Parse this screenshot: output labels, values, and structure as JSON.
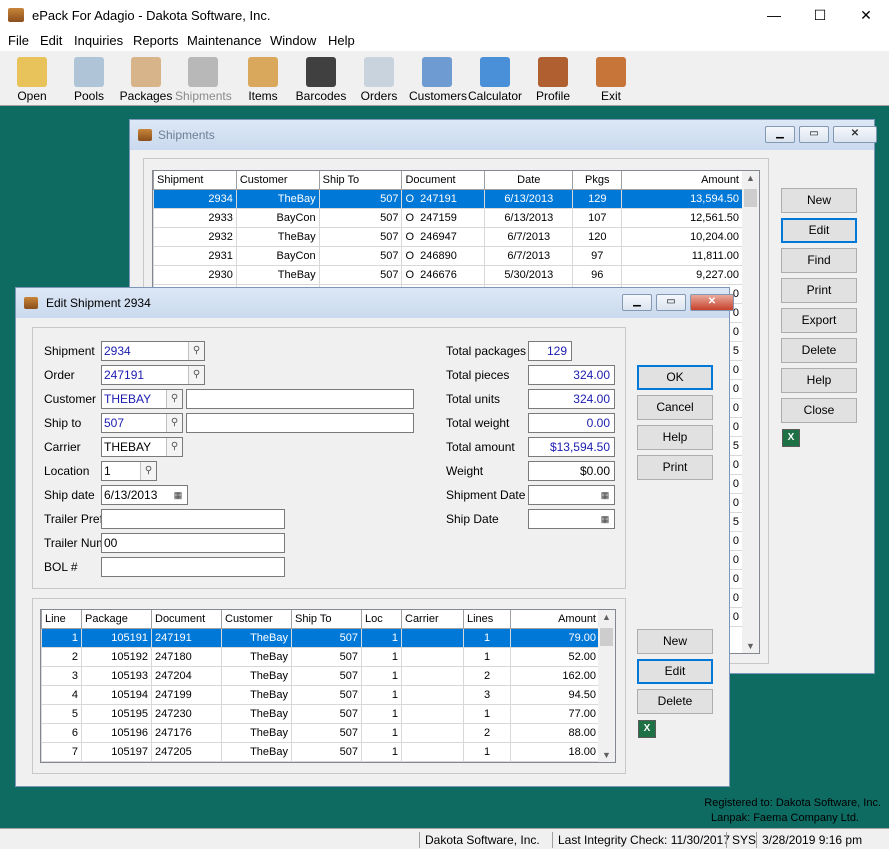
{
  "app": {
    "title": "ePack For Adagio - Dakota Software, Inc.",
    "window_controls": {
      "minimize": "—",
      "maximize": "☐",
      "close": "✕"
    }
  },
  "menu": [
    "File",
    "Edit",
    "Inquiries",
    "Reports",
    "Maintenance",
    "Window",
    "Help"
  ],
  "toolbar": [
    {
      "label": "Open",
      "icon": "folder-icon",
      "color": "#e8c25a"
    },
    {
      "label": "Pools",
      "icon": "pools-icon",
      "color": "#b0c4d8"
    },
    {
      "label": "Packages",
      "icon": "packages-icon",
      "color": "#d7b48a"
    },
    {
      "label": "Shipments",
      "icon": "truck-icon",
      "color": "#b8b8b8",
      "disabled": true
    },
    {
      "label": "Items",
      "icon": "boxes-icon",
      "color": "#d9a85c"
    },
    {
      "label": "Barcodes",
      "icon": "barcode-icon",
      "color": "#404040"
    },
    {
      "label": "Orders",
      "icon": "orders-icon",
      "color": "#c9d3de"
    },
    {
      "label": "Customers",
      "icon": "customers-icon",
      "color": "#6e9bd1"
    },
    {
      "label": "Calculator",
      "icon": "calculator-icon",
      "color": "#4a90d9"
    },
    {
      "label": "Profile",
      "icon": "tools-icon",
      "color": "#b06030"
    },
    {
      "label": "Exit",
      "icon": "exit-icon",
      "color": "#c8753a"
    }
  ],
  "shipments": {
    "title": "Shipments",
    "columns": [
      "Shipment",
      "Customer",
      "Ship To",
      "Document",
      "Date",
      "Pkgs",
      "Amount"
    ],
    "rows": [
      [
        "2934",
        "TheBay",
        "507",
        "O",
        "247191",
        "6/13/2013",
        "129",
        "13,594.50"
      ],
      [
        "2933",
        "BayCon",
        "507",
        "O",
        "247159",
        "6/13/2013",
        "107",
        "12,561.50"
      ],
      [
        "2932",
        "TheBay",
        "507",
        "O",
        "246947",
        "6/7/2013",
        "120",
        "10,204.00"
      ],
      [
        "2931",
        "BayCon",
        "507",
        "O",
        "246890",
        "6/7/2013",
        "97",
        "11,811.00"
      ],
      [
        "2930",
        "TheBay",
        "507",
        "O",
        "246676",
        "5/30/2013",
        "96",
        "9,227.00"
      ]
    ],
    "amount_tails": [
      "0",
      "0",
      "0",
      "5",
      "0",
      "0",
      "0",
      "0",
      "5",
      "0",
      "0",
      "0",
      "5",
      "0",
      "0",
      "0",
      "0",
      "0"
    ],
    "buttons": [
      "New",
      "Edit",
      "Find",
      "Print",
      "Export",
      "Delete",
      "Help",
      "Close"
    ]
  },
  "edit": {
    "title": "Edit Shipment 2934",
    "fields": {
      "shipment_label": "Shipment",
      "shipment": "2934",
      "order_label": "Order",
      "order": "247191",
      "customer_label": "Customer",
      "customer": "THEBAY",
      "customer_name": "",
      "shipto_label": "Ship to",
      "shipto": "507",
      "shipto_name": "",
      "carrier_label": "Carrier",
      "carrier": "THEBAY",
      "location_label": "Location",
      "location": "1",
      "shipdate_label": "Ship date",
      "shipdate": "6/13/2013",
      "trailer_prefix_label": "Trailer Prefi",
      "trailer_prefix": "",
      "trailer_num_label": "Trailer Num",
      "trailer_num": "00",
      "bol_label": "BOL #",
      "bol": ""
    },
    "totals": {
      "packages_label": "Total packages",
      "packages": "129",
      "pieces_label": "Total pieces",
      "pieces": "324.00",
      "units_label": "Total units",
      "units": "324.00",
      "weight_label": "Total weight",
      "weight": "0.00",
      "amount_label": "Total amount",
      "amount": "$13,594.50",
      "w_label": "Weight",
      "w": "$0.00",
      "shipment_date_label": "Shipment Date",
      "shipment_date": "",
      "ship_date_label": "Ship Date",
      "ship_date": ""
    },
    "buttons": [
      "OK",
      "Cancel",
      "Help",
      "Print"
    ],
    "lines_columns": [
      "Line",
      "Package",
      "Document",
      "Customer",
      "Ship To",
      "Loc",
      "Carrier",
      "Lines",
      "Amount"
    ],
    "lines": [
      [
        "1",
        "105191",
        "247191",
        "TheBay",
        "507",
        "1",
        "",
        "1",
        "79.00"
      ],
      [
        "2",
        "105192",
        "247180",
        "TheBay",
        "507",
        "1",
        "",
        "1",
        "52.00"
      ],
      [
        "3",
        "105193",
        "247204",
        "TheBay",
        "507",
        "1",
        "",
        "2",
        "162.00"
      ],
      [
        "4",
        "105194",
        "247199",
        "TheBay",
        "507",
        "1",
        "",
        "3",
        "94.50"
      ],
      [
        "5",
        "105195",
        "247230",
        "TheBay",
        "507",
        "1",
        "",
        "1",
        "77.00"
      ],
      [
        "6",
        "105196",
        "247176",
        "TheBay",
        "507",
        "1",
        "",
        "2",
        "88.00"
      ],
      [
        "7",
        "105197",
        "247205",
        "TheBay",
        "507",
        "1",
        "",
        "1",
        "18.00"
      ]
    ],
    "line_buttons": [
      "New",
      "Edit",
      "Delete"
    ]
  },
  "registration": [
    "Registered to: Dakota Software, Inc.",
    "Lanpak: Faema Company Ltd."
  ],
  "status": [
    "Dakota Software, Inc.",
    "Last Integrity Check: 11/30/2017",
    "SYS",
    "3/28/2019 9:16 pm"
  ]
}
